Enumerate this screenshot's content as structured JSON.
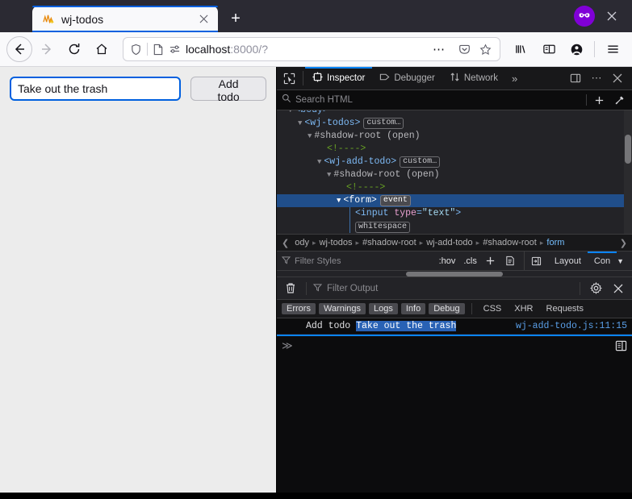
{
  "browser": {
    "tab": {
      "title": "wj-todos",
      "favicon_icon": "chart-squiggle-favicon",
      "close_icon": "close-icon"
    },
    "new_tab_label": "+",
    "private_badge_icon": "private-browsing-mask-icon",
    "window_close_icon": "close-icon",
    "nav": {
      "back_icon": "back-arrow-icon",
      "forward_icon": "forward-arrow-icon",
      "reload_icon": "reload-icon",
      "home_icon": "home-icon",
      "shield_icon": "shield-icon",
      "page_icon": "page-icon",
      "permissions_icon": "permissions-icon",
      "url_host": "localhost",
      "url_rest": ":8000/?",
      "page_actions_icon": "ellipsis-icon",
      "save_to_pocket_icon": "pocket-icon",
      "bookmark_icon": "star-icon",
      "library_icon": "library-icon",
      "sidebars_icon": "sidebar-icon",
      "account_icon": "account-icon",
      "menu_icon": "hamburger-menu-icon"
    }
  },
  "page": {
    "todo_input_value": "Take out the trash",
    "todo_input_placeholder": "",
    "add_button_label": "Add todo",
    "accent_color": "#0060df",
    "background_color": "#ececec"
  },
  "devtools": {
    "toolbar": {
      "picker_icon": "element-picker-icon",
      "tabs": [
        {
          "label": "Inspector",
          "icon": "inspector-icon",
          "active": true
        },
        {
          "label": "Debugger",
          "icon": "debugger-icon",
          "active": false
        },
        {
          "label": "Network",
          "icon": "network-icon",
          "active": false
        }
      ],
      "overflow_icon": "chevron-double-right-icon",
      "dock_icon": "dock-to-side-icon",
      "meatball_icon": "ellipsis-icon",
      "close_icon": "close-icon",
      "active_tab_underline_color": "#0a84ff"
    },
    "search": {
      "placeholder": "Search HTML",
      "search_icon": "search-icon",
      "add_node_icon": "plus-icon",
      "eyedropper_icon": "eyedropper-icon"
    },
    "dom_tree": [
      {
        "indent": 0,
        "twisty": "▼",
        "text": "<body>",
        "kind": "tag",
        "selected": false,
        "partial": true
      },
      {
        "indent": 1,
        "twisty": "▼",
        "text": "<wj-todos>",
        "kind": "tag",
        "badge": "custom…",
        "selected": false
      },
      {
        "indent": 2,
        "twisty": "▼",
        "text": "#shadow-root (open)",
        "kind": "shadow",
        "selected": false
      },
      {
        "indent": 3,
        "twisty": "",
        "text": "<!---->",
        "kind": "comment",
        "selected": false
      },
      {
        "indent": 3,
        "twisty": "▼",
        "text": "<wj-add-todo>",
        "kind": "tag",
        "badge": "custom…",
        "selected": false
      },
      {
        "indent": 4,
        "twisty": "▼",
        "text": "#shadow-root (open)",
        "kind": "shadow",
        "selected": false
      },
      {
        "indent": 5,
        "twisty": "",
        "text": "<!---->",
        "kind": "comment",
        "selected": false
      },
      {
        "indent": 5,
        "twisty": "▼",
        "text": "<form>",
        "kind": "tag",
        "badge": "event",
        "selected": true
      },
      {
        "indent": 6,
        "twisty": "",
        "text": "<input type=\"text\">",
        "kind": "input",
        "selected": false
      },
      {
        "indent": 6,
        "twisty": "",
        "text": "whitespace",
        "kind": "whitespace",
        "selected": false
      }
    ],
    "breadcrumb": {
      "left_arrow_icon": "chevron-left-icon",
      "right_arrow_icon": "chevron-right-icon",
      "items": [
        {
          "label": "ody",
          "active": false
        },
        {
          "label": "wj-todos",
          "active": false
        },
        {
          "label": "#shadow-root",
          "active": false
        },
        {
          "label": "wj-add-todo",
          "active": false
        },
        {
          "label": "#shadow-root",
          "active": false
        },
        {
          "label": "form",
          "active": true
        }
      ],
      "separator": "›"
    },
    "styles_bar": {
      "filter_icon": "filter-icon",
      "filter_placeholder": "Filter Styles",
      "hov_label": ":hov",
      "cls_label": ".cls",
      "add_rule_icon": "plus-icon",
      "print_icon": "document-icon",
      "panel_toggle_icon": "panel-toggle-icon",
      "layout_label": "Layout",
      "computed_label": "Con",
      "caret_icon": "caret-down-icon"
    },
    "console": {
      "trash_icon": "trash-icon",
      "filter_placeholder": "Filter Output",
      "settings_icon": "gear-icon",
      "close_icon": "close-icon",
      "filters": [
        {
          "label": "Errors",
          "active": true
        },
        {
          "label": "Warnings",
          "active": true
        },
        {
          "label": "Logs",
          "active": true
        },
        {
          "label": "Info",
          "active": true
        },
        {
          "label": "Debug",
          "active": true
        },
        {
          "label": "CSS",
          "active": false
        },
        {
          "label": "XHR",
          "active": false
        },
        {
          "label": "Requests",
          "active": false
        }
      ],
      "messages": [
        {
          "text": "Add todo ",
          "highlighted": "Take out the trash",
          "source": "wj-add-todo.js:11:15"
        }
      ],
      "prompt": "≫",
      "split_console_icon": "split-console-icon"
    }
  }
}
